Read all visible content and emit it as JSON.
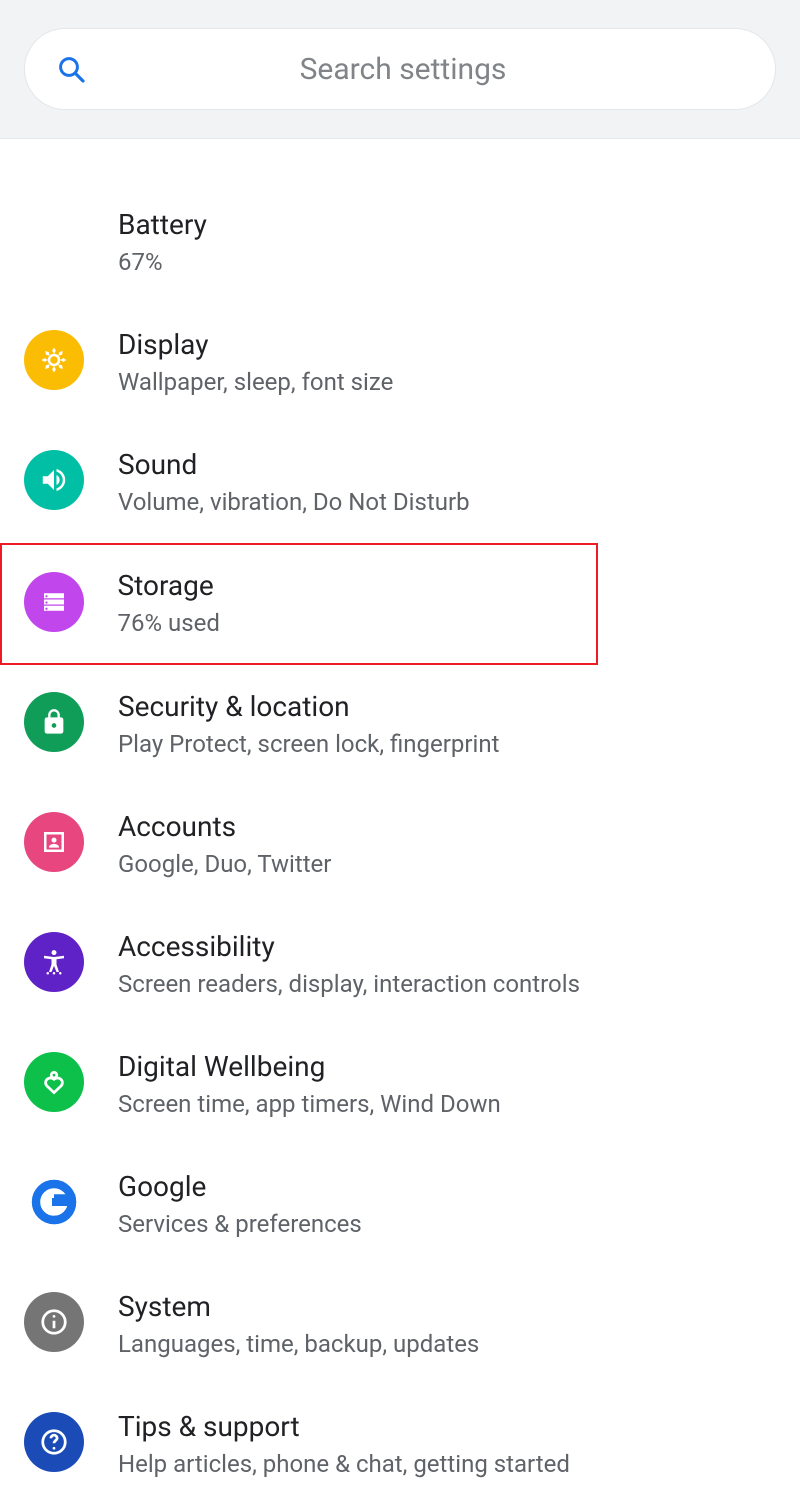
{
  "search": {
    "placeholder": "Search settings"
  },
  "items": [
    {
      "id": "battery",
      "title": "Battery",
      "sub": "67%",
      "color": "#167b6b",
      "highlighted": false
    },
    {
      "id": "display",
      "title": "Display",
      "sub": "Wallpaper, sleep, font size",
      "color": "#fbbc04",
      "highlighted": false
    },
    {
      "id": "sound",
      "title": "Sound",
      "sub": "Volume, vibration, Do Not Disturb",
      "color": "#00bfa5",
      "highlighted": false
    },
    {
      "id": "storage",
      "title": "Storage",
      "sub": "76% used",
      "color": "#c146ec",
      "highlighted": true
    },
    {
      "id": "security",
      "title": "Security & location",
      "sub": "Play Protect, screen lock, fingerprint",
      "color": "#0f9d58",
      "highlighted": false
    },
    {
      "id": "accounts",
      "title": "Accounts",
      "sub": "Google, Duo, Twitter",
      "color": "#e8467f",
      "highlighted": false
    },
    {
      "id": "a11y",
      "title": "Accessibility",
      "sub": "Screen readers, display, interaction controls",
      "color": "#5f22c6",
      "highlighted": false
    },
    {
      "id": "wellbeing",
      "title": "Digital Wellbeing",
      "sub": "Screen time, app timers, Wind Down",
      "color": "#0cc04a",
      "highlighted": false
    },
    {
      "id": "google",
      "title": "Google",
      "sub": "Services & preferences",
      "color": "#ffffff",
      "highlighted": false
    },
    {
      "id": "system",
      "title": "System",
      "sub": "Languages, time, backup, updates",
      "color": "#757575",
      "highlighted": false
    },
    {
      "id": "tips",
      "title": "Tips & support",
      "sub": "Help articles, phone & chat, getting started",
      "color": "#1a4bb7",
      "highlighted": false
    }
  ]
}
